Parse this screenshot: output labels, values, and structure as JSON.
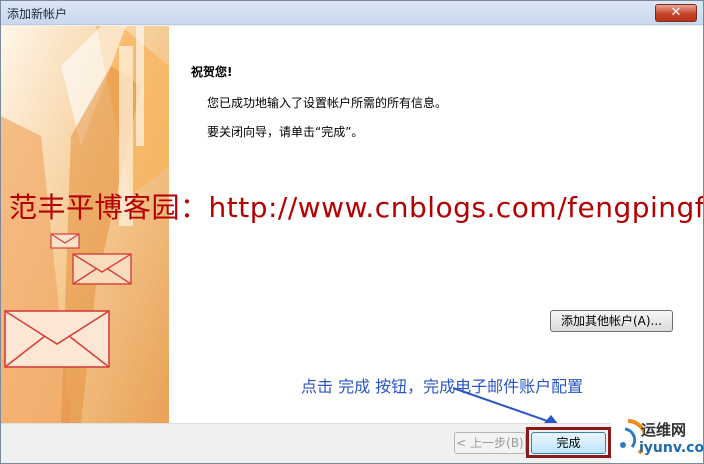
{
  "window": {
    "title": "添加新帐户",
    "close_glyph": "✕"
  },
  "content": {
    "heading": "祝贺您!",
    "line1": "您已成功地输入了设置帐户所需的所有信息。",
    "line2": "要关闭向导，请单击“完成”。",
    "add_account_label": "添加其他帐户(A)..."
  },
  "watermark": {
    "text": "范丰平博客园：http://www.cnblogs.com/fengpingfan/",
    "color": "#b40000"
  },
  "annotation": {
    "text": "点击 完成 按钮，完成电子邮件账户配置",
    "color": "#2a55c9"
  },
  "footer": {
    "back_label": "< 上一步(B)",
    "finish_label": "完成"
  },
  "logo": {
    "name_cn": "运维网",
    "domain": "iyunv.com"
  }
}
